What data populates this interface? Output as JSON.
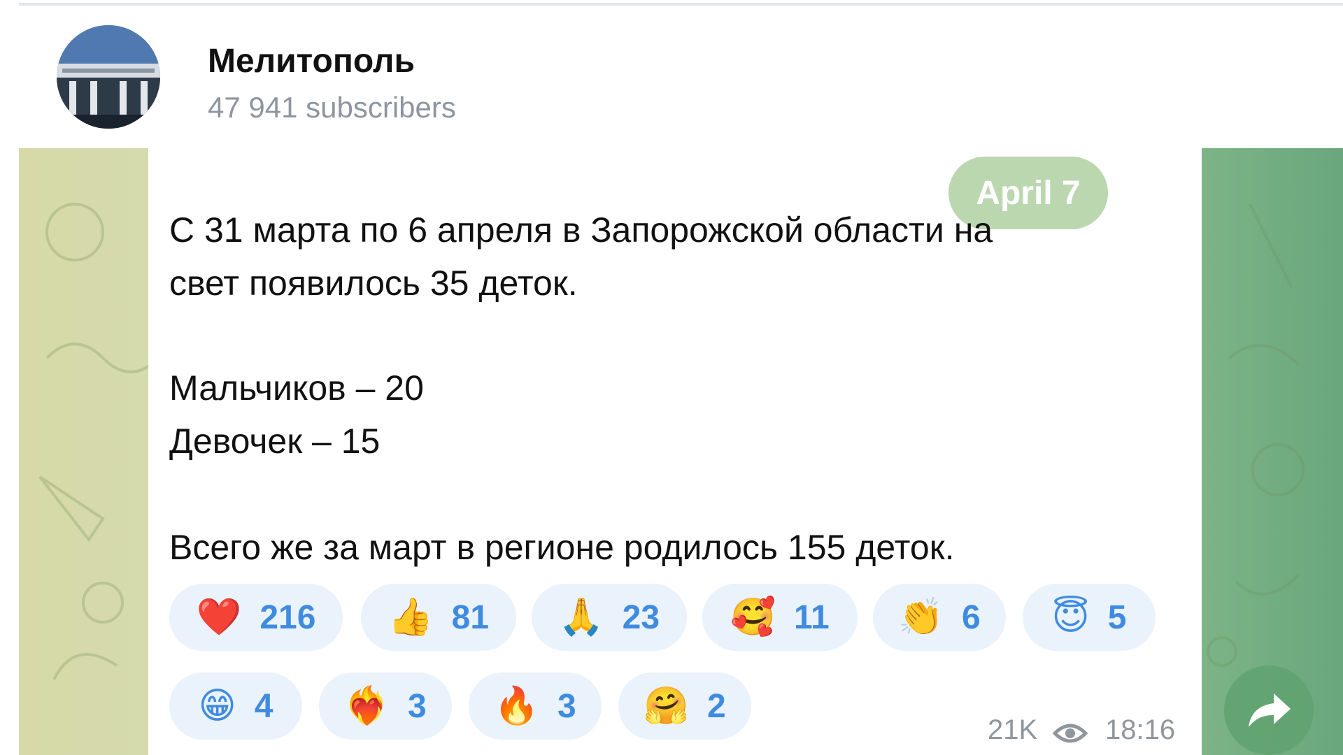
{
  "channel": {
    "name": "Мелитополь",
    "subscribers": "47 941 subscribers"
  },
  "message": {
    "date_pill": "April 7",
    "lines": [
      "С 31 марта по 6 апреля в Запорожской области на",
      "свет появилось 35 деток.",
      "Мальчиков – 20",
      "Девочек – 15",
      "Всего же за март в регионе родилось 155 деток."
    ],
    "views": "21K",
    "time": "18:16"
  },
  "reactions": [
    {
      "emoji": "❤️",
      "icon": "red-heart-icon",
      "count": "216"
    },
    {
      "emoji": "👍",
      "icon": "thumbs-up-icon",
      "count": "81"
    },
    {
      "emoji": "🙏",
      "icon": "folded-hands-icon",
      "count": "23"
    },
    {
      "emoji": "🥰",
      "icon": "smiling-face-hearts-icon",
      "count": "11"
    },
    {
      "emoji": "👏",
      "icon": "clapping-hands-icon",
      "count": "6"
    },
    {
      "emoji": "😇",
      "icon": "halo-face-icon",
      "count": "5"
    },
    {
      "emoji": "😁",
      "icon": "grinning-face-icon",
      "count": "4"
    },
    {
      "emoji": "❤️‍🔥",
      "icon": "heart-on-fire-icon",
      "count": "3"
    },
    {
      "emoji": "🔥",
      "icon": "fire-icon",
      "count": "3"
    },
    {
      "emoji": "🤗",
      "icon": "hugging-face-icon",
      "count": "2"
    }
  ],
  "colors": {
    "reaction_bg": "#eaf2fb",
    "reaction_text": "#3f8be0",
    "chat_bg_left": "#d7d9a9",
    "chat_bg_right": "#69a77c",
    "date_pill": "#a4c996"
  }
}
